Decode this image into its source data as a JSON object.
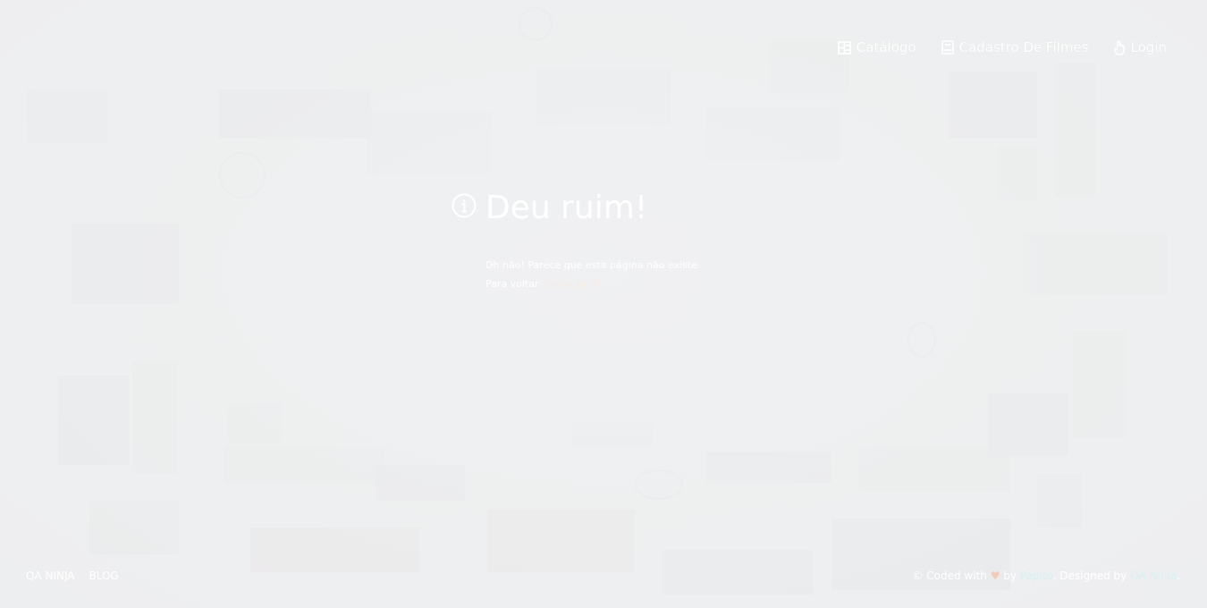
{
  "nav": {
    "items": [
      {
        "label": "Catálogo",
        "icon": "catalog-grid-icon"
      },
      {
        "label": "Cadastro De Filmes",
        "icon": "register-form-icon"
      },
      {
        "label": "Login",
        "icon": "login-hand-icon"
      }
    ]
  },
  "error": {
    "icon": "info-icon",
    "title": "Deu ruim!",
    "line1": "Oh não! Parece que esta página não existe.",
    "line2_prefix": "Para voltar",
    "line2_link": "clique aqui!"
  },
  "footer": {
    "left": [
      "QA NINJA",
      "BLOG"
    ],
    "coded_prefix": "© Coded with",
    "heart": "♥",
    "by": "by",
    "author": "Papito",
    "designed_by": ". Designed by",
    "designer": "QA Ninja",
    "end": "."
  },
  "colors": {
    "background": "#eeeff0",
    "text": "#ffffff"
  }
}
